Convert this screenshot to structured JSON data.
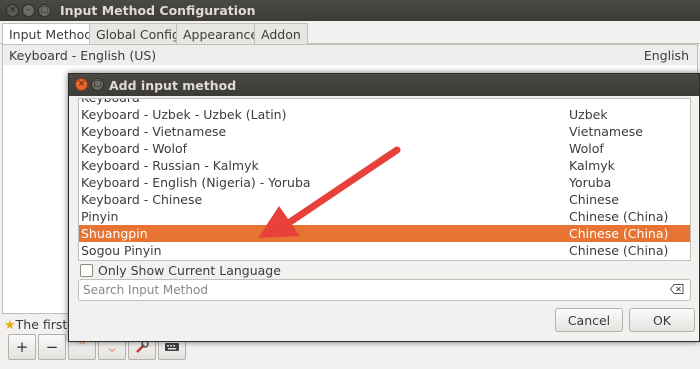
{
  "main_window": {
    "title": "Input Method Configuration",
    "tabs": [
      "Input Method",
      "Global Config",
      "Appearance",
      "Addon"
    ],
    "active_tab": "Input Method",
    "current_methods": [
      {
        "name": "Keyboard - English (US)",
        "language": "English"
      }
    ],
    "hint_text": "The first",
    "toolbar": {
      "add_label": "+",
      "remove_label": "−",
      "up_label": "⌃",
      "down_label": "⌄"
    }
  },
  "dialog": {
    "title": "Add input method",
    "rows": [
      {
        "name": "Keyboard - Uzbek - Uzbek (Latin)",
        "language": "Uzbek"
      },
      {
        "name": "Keyboard - Vietnamese",
        "language": "Vietnamese"
      },
      {
        "name": "Keyboard - Wolof",
        "language": "Wolof"
      },
      {
        "name": "Keyboard - Russian - Kalmyk",
        "language": "Kalmyk"
      },
      {
        "name": "Keyboard - English (Nigeria) - Yoruba",
        "language": "Yoruba"
      },
      {
        "name": "Keyboard - Chinese",
        "language": "Chinese"
      },
      {
        "name": "Pinyin",
        "language": "Chinese (China)"
      },
      {
        "name": "Shuangpin",
        "language": "Chinese (China)"
      },
      {
        "name": "Sogou Pinyin",
        "language": "Chinese (China)"
      }
    ],
    "selected_row": "Shuangpin",
    "only_current_language_label": "Only Show Current Language",
    "only_current_language_checked": false,
    "search": {
      "placeholder": "Search Input Method",
      "value": ""
    },
    "cancel_label": "Cancel",
    "ok_label": "OK"
  },
  "colors": {
    "selection": "#e87433",
    "annotation_arrow": "#e8413c",
    "titlebar": "#3c3b37"
  }
}
